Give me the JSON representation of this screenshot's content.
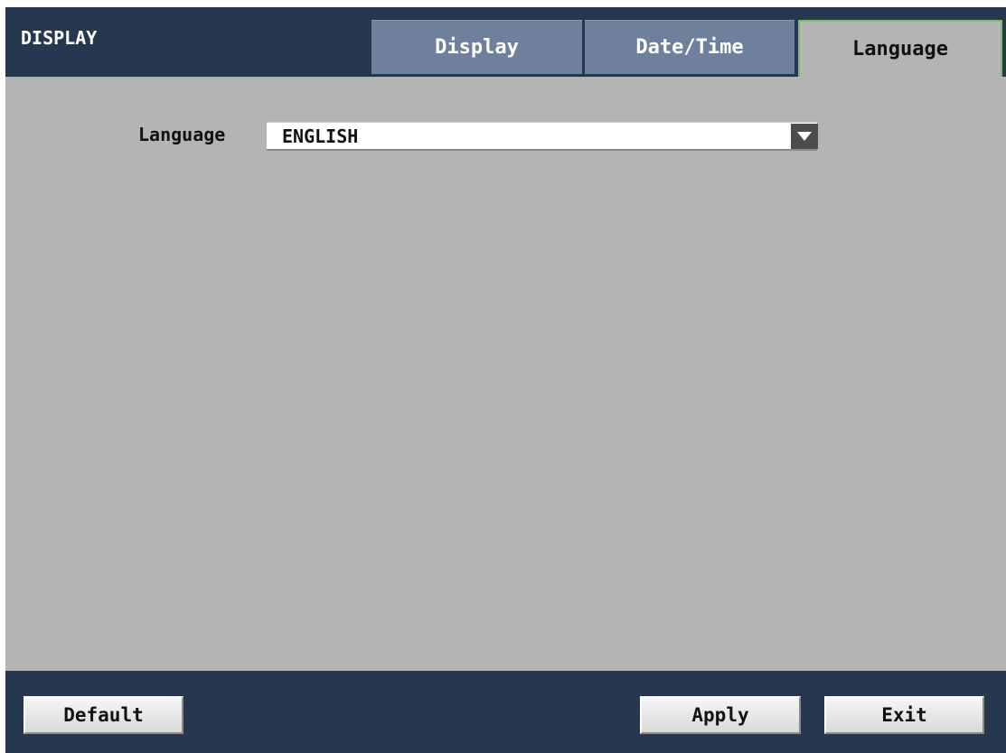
{
  "window": {
    "title": "DISPLAY"
  },
  "tabs": [
    {
      "label": "Display",
      "active": false
    },
    {
      "label": "Date/Time",
      "active": false
    },
    {
      "label": "Language",
      "active": true
    }
  ],
  "language": {
    "label": "Language",
    "selected": "ENGLISH"
  },
  "footer": {
    "default_label": "Default",
    "apply_label": "Apply",
    "exit_label": "Exit"
  },
  "colors": {
    "header_bg": "#283750",
    "tab_inactive_bg": "#6f809c",
    "content_bg": "#b4b4b4",
    "active_tab_border": "#7dbb6e"
  },
  "icons": {
    "dropdown": "chevron-down-icon"
  }
}
